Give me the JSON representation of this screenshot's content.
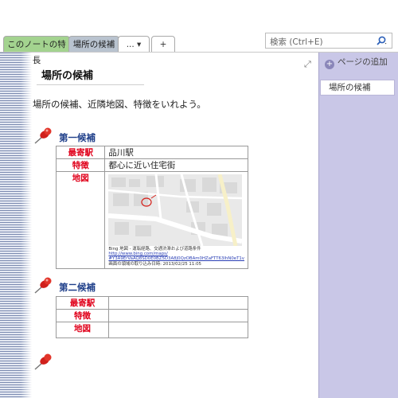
{
  "tabs": [
    {
      "label": "このノートの特長"
    },
    {
      "label": "場所の候補"
    },
    {
      "label": "... ▾"
    },
    {
      "label": "+"
    }
  ],
  "search": {
    "placeholder": "検索 (Ctrl+E)"
  },
  "right_panel": {
    "add_page_label": "ページの追加",
    "pages": [
      {
        "label": "場所の候補"
      }
    ]
  },
  "page": {
    "title": "場所の候補",
    "intro": "場所の候補、近隣地図、特徴をいれよう。"
  },
  "candidates": [
    {
      "heading": "第一候補",
      "rows": [
        {
          "label": "最寄駅",
          "value": "品川駅"
        },
        {
          "label": "特徴",
          "value": "都心に近い住宅街"
        },
        {
          "label": "地図",
          "value": ""
        }
      ],
      "map_caption": {
        "line1": "Bing 地図 - 運転経路、交通渋滞および道路条件",
        "link1": "http://www.bing.com/maps/",
        "link2": "#Y3A9ErVaAQ8SD0E0BZ5D3A8J0QzOBAm0HZaFTT63lhN0eT1v",
        "line4": "画面の領域の取り込み日時: 2013/02/25 11:05"
      }
    },
    {
      "heading": "第二候補",
      "rows": [
        {
          "label": "最寄駅",
          "value": ""
        },
        {
          "label": "特徴",
          "value": ""
        },
        {
          "label": "地図",
          "value": ""
        }
      ]
    }
  ],
  "colors": {
    "active_tab": "#b9c3cf",
    "first_tab": "#a3d38f",
    "right_panel": "#c9c7e7",
    "heading_blue": "#1f3f8a",
    "label_red": "#e0001a"
  },
  "icons": [
    "search-icon",
    "expand-icon",
    "add-page-icon",
    "pushpin-icon"
  ]
}
